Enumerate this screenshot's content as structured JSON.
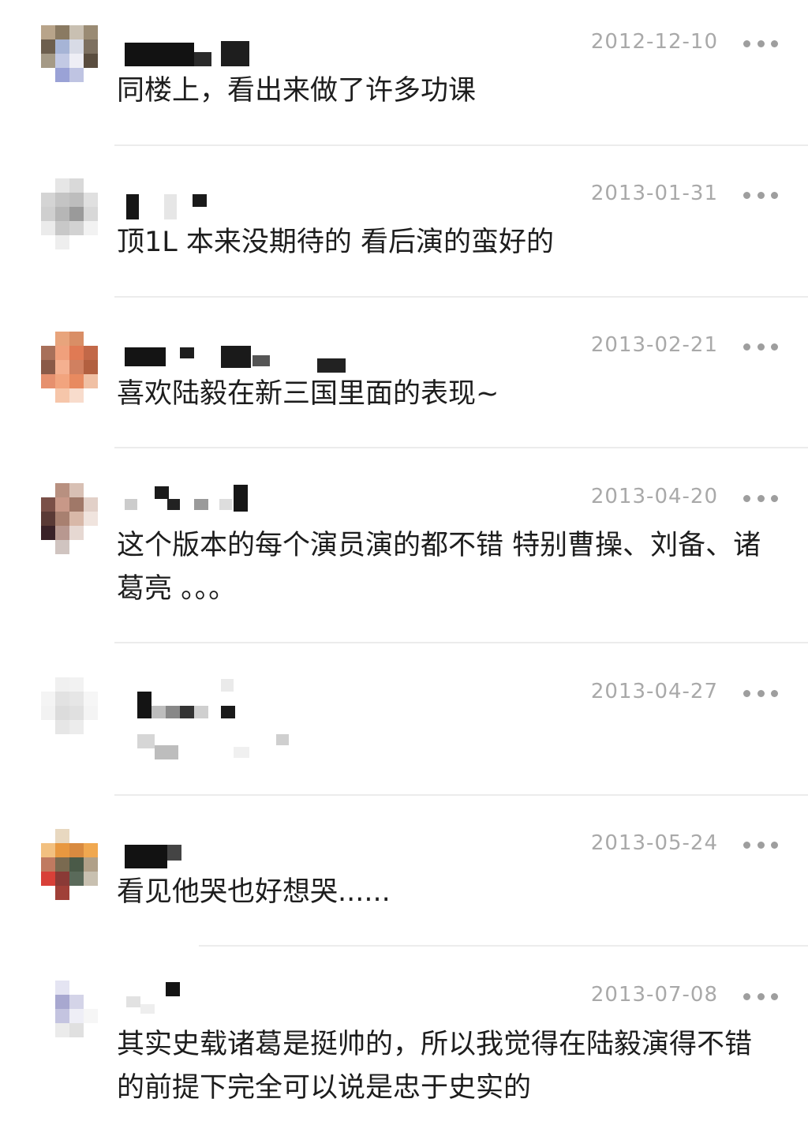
{
  "comments": [
    {
      "date": "2012-12-10",
      "text": "同楼上，看出来做了许多功课"
    },
    {
      "date": "2013-01-31",
      "text": "顶1L 本来没期待的 看后演的蛮好的"
    },
    {
      "date": "2013-02-21",
      "text": "喜欢陆毅在新三国里面的表现~"
    },
    {
      "date": "2013-04-20",
      "text": "这个版本的每个演员演的都不错 特别曹操、刘备、诸葛亮 。。。"
    },
    {
      "date": "2013-04-27",
      "text": ""
    },
    {
      "date": "2013-05-24",
      "text": "看见他哭也好想哭......"
    },
    {
      "date": "2013-07-08",
      "text": "其实史载诸葛是挺帅的，所以我觉得在陆毅演得不错的前提下完全可以说是忠于史实的"
    }
  ],
  "icons": {
    "more": "more-dots-icon",
    "avatar": "pixelated-avatar"
  },
  "colors": {
    "date": "#a9a9a9",
    "text": "#1d1d1d",
    "divider": "#ececec",
    "more": "#9e9e9e"
  }
}
